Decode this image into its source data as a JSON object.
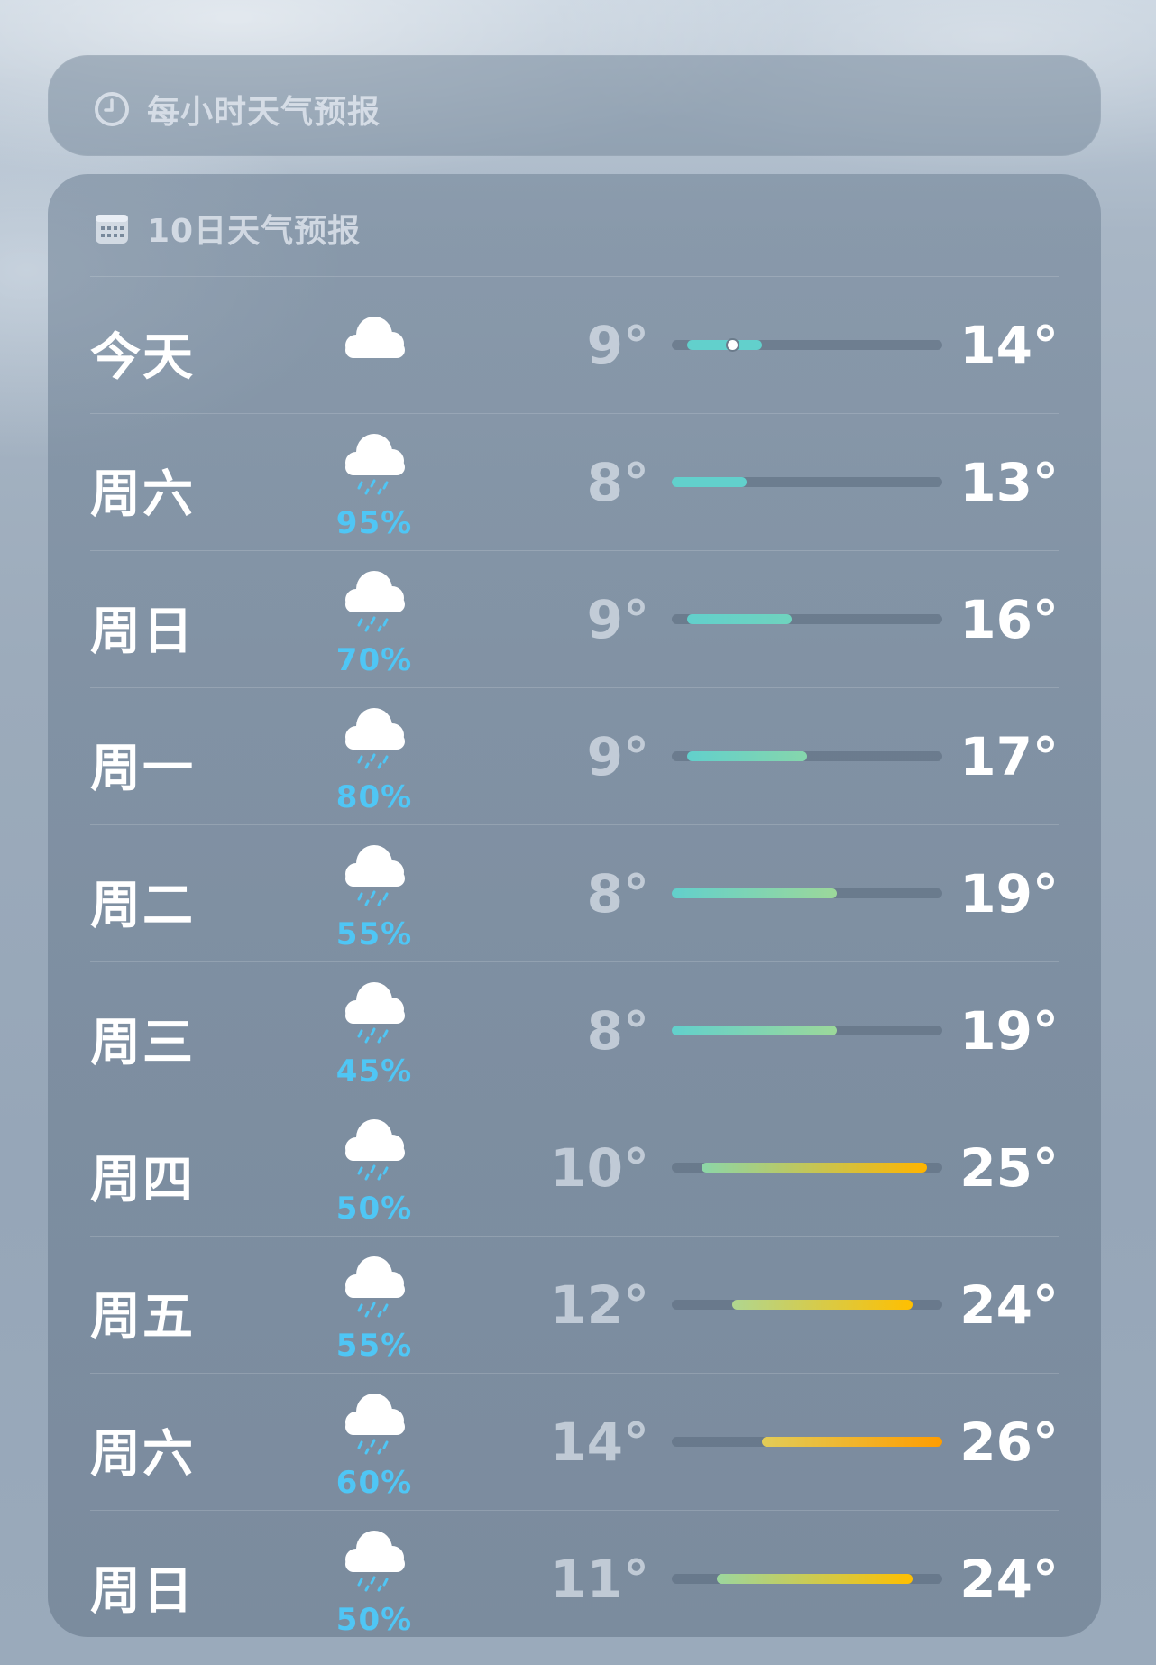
{
  "hourly": {
    "title": "每小时天气预报",
    "icon": "clock-icon"
  },
  "ten_day": {
    "title": "10日天气预报",
    "icon": "calendar-icon",
    "range_min": 8,
    "range_max": 26,
    "current_temp_marker": 12,
    "rows": [
      {
        "day": "今天",
        "condition": "cloudy",
        "precip": "",
        "low": "9°",
        "high": "14°",
        "low_value": 9,
        "high_value": 14,
        "bar_colors": [
          "#62d0cc",
          "#62d0cc"
        ]
      },
      {
        "day": "周六",
        "condition": "rain",
        "precip": "95%",
        "low": "8°",
        "high": "13°",
        "low_value": 8,
        "high_value": 13,
        "bar_colors": [
          "#62d0cc",
          "#62d0cc"
        ]
      },
      {
        "day": "周日",
        "condition": "rain",
        "precip": "70%",
        "low": "9°",
        "high": "16°",
        "low_value": 9,
        "high_value": 16,
        "bar_colors": [
          "#62d0cc",
          "#6fd3be"
        ]
      },
      {
        "day": "周一",
        "condition": "rain",
        "precip": "80%",
        "low": "9°",
        "high": "17°",
        "low_value": 9,
        "high_value": 17,
        "bar_colors": [
          "#62d0cc",
          "#86d6ac"
        ]
      },
      {
        "day": "周二",
        "condition": "rain",
        "precip": "55%",
        "low": "8°",
        "high": "19°",
        "low_value": 8,
        "high_value": 19,
        "bar_colors": [
          "#62d0cc",
          "#9cd89a"
        ]
      },
      {
        "day": "周三",
        "condition": "rain",
        "precip": "45%",
        "low": "8°",
        "high": "19°",
        "low_value": 8,
        "high_value": 19,
        "bar_colors": [
          "#62d0cc",
          "#9cd89a"
        ]
      },
      {
        "day": "周四",
        "condition": "rain",
        "precip": "50%",
        "low": "10°",
        "high": "25°",
        "low_value": 10,
        "high_value": 25,
        "bar_colors": [
          "#8cd6a8",
          "#ffb400"
        ]
      },
      {
        "day": "周五",
        "condition": "rain",
        "precip": "55%",
        "low": "12°",
        "high": "24°",
        "low_value": 12,
        "high_value": 24,
        "bar_colors": [
          "#b0d690",
          "#ffbf00"
        ]
      },
      {
        "day": "周六",
        "condition": "rain",
        "precip": "60%",
        "low": "14°",
        "high": "26°",
        "low_value": 14,
        "high_value": 26,
        "bar_colors": [
          "#e2cc58",
          "#ff9d00"
        ]
      },
      {
        "day": "周日",
        "condition": "rain",
        "precip": "50%",
        "low": "11°",
        "high": "24°",
        "low_value": 11,
        "high_value": 24,
        "bar_colors": [
          "#9cd69e",
          "#ffbf00"
        ]
      }
    ]
  }
}
